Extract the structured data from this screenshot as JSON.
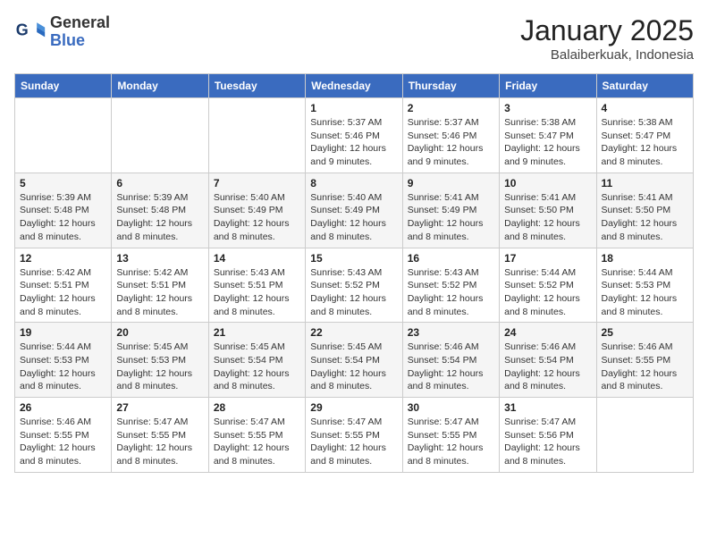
{
  "logo": {
    "line1": "General",
    "line2": "Blue"
  },
  "title": "January 2025",
  "subtitle": "Balaiberkuak, Indonesia",
  "headers": [
    "Sunday",
    "Monday",
    "Tuesday",
    "Wednesday",
    "Thursday",
    "Friday",
    "Saturday"
  ],
  "weeks": [
    [
      {
        "day": "",
        "info": ""
      },
      {
        "day": "",
        "info": ""
      },
      {
        "day": "",
        "info": ""
      },
      {
        "day": "1",
        "info": "Sunrise: 5:37 AM\nSunset: 5:46 PM\nDaylight: 12 hours and 9 minutes."
      },
      {
        "day": "2",
        "info": "Sunrise: 5:37 AM\nSunset: 5:46 PM\nDaylight: 12 hours and 9 minutes."
      },
      {
        "day": "3",
        "info": "Sunrise: 5:38 AM\nSunset: 5:47 PM\nDaylight: 12 hours and 9 minutes."
      },
      {
        "day": "4",
        "info": "Sunrise: 5:38 AM\nSunset: 5:47 PM\nDaylight: 12 hours and 8 minutes."
      }
    ],
    [
      {
        "day": "5",
        "info": "Sunrise: 5:39 AM\nSunset: 5:48 PM\nDaylight: 12 hours and 8 minutes."
      },
      {
        "day": "6",
        "info": "Sunrise: 5:39 AM\nSunset: 5:48 PM\nDaylight: 12 hours and 8 minutes."
      },
      {
        "day": "7",
        "info": "Sunrise: 5:40 AM\nSunset: 5:49 PM\nDaylight: 12 hours and 8 minutes."
      },
      {
        "day": "8",
        "info": "Sunrise: 5:40 AM\nSunset: 5:49 PM\nDaylight: 12 hours and 8 minutes."
      },
      {
        "day": "9",
        "info": "Sunrise: 5:41 AM\nSunset: 5:49 PM\nDaylight: 12 hours and 8 minutes."
      },
      {
        "day": "10",
        "info": "Sunrise: 5:41 AM\nSunset: 5:50 PM\nDaylight: 12 hours and 8 minutes."
      },
      {
        "day": "11",
        "info": "Sunrise: 5:41 AM\nSunset: 5:50 PM\nDaylight: 12 hours and 8 minutes."
      }
    ],
    [
      {
        "day": "12",
        "info": "Sunrise: 5:42 AM\nSunset: 5:51 PM\nDaylight: 12 hours and 8 minutes."
      },
      {
        "day": "13",
        "info": "Sunrise: 5:42 AM\nSunset: 5:51 PM\nDaylight: 12 hours and 8 minutes."
      },
      {
        "day": "14",
        "info": "Sunrise: 5:43 AM\nSunset: 5:51 PM\nDaylight: 12 hours and 8 minutes."
      },
      {
        "day": "15",
        "info": "Sunrise: 5:43 AM\nSunset: 5:52 PM\nDaylight: 12 hours and 8 minutes."
      },
      {
        "day": "16",
        "info": "Sunrise: 5:43 AM\nSunset: 5:52 PM\nDaylight: 12 hours and 8 minutes."
      },
      {
        "day": "17",
        "info": "Sunrise: 5:44 AM\nSunset: 5:52 PM\nDaylight: 12 hours and 8 minutes."
      },
      {
        "day": "18",
        "info": "Sunrise: 5:44 AM\nSunset: 5:53 PM\nDaylight: 12 hours and 8 minutes."
      }
    ],
    [
      {
        "day": "19",
        "info": "Sunrise: 5:44 AM\nSunset: 5:53 PM\nDaylight: 12 hours and 8 minutes."
      },
      {
        "day": "20",
        "info": "Sunrise: 5:45 AM\nSunset: 5:53 PM\nDaylight: 12 hours and 8 minutes."
      },
      {
        "day": "21",
        "info": "Sunrise: 5:45 AM\nSunset: 5:54 PM\nDaylight: 12 hours and 8 minutes."
      },
      {
        "day": "22",
        "info": "Sunrise: 5:45 AM\nSunset: 5:54 PM\nDaylight: 12 hours and 8 minutes."
      },
      {
        "day": "23",
        "info": "Sunrise: 5:46 AM\nSunset: 5:54 PM\nDaylight: 12 hours and 8 minutes."
      },
      {
        "day": "24",
        "info": "Sunrise: 5:46 AM\nSunset: 5:54 PM\nDaylight: 12 hours and 8 minutes."
      },
      {
        "day": "25",
        "info": "Sunrise: 5:46 AM\nSunset: 5:55 PM\nDaylight: 12 hours and 8 minutes."
      }
    ],
    [
      {
        "day": "26",
        "info": "Sunrise: 5:46 AM\nSunset: 5:55 PM\nDaylight: 12 hours and 8 minutes."
      },
      {
        "day": "27",
        "info": "Sunrise: 5:47 AM\nSunset: 5:55 PM\nDaylight: 12 hours and 8 minutes."
      },
      {
        "day": "28",
        "info": "Sunrise: 5:47 AM\nSunset: 5:55 PM\nDaylight: 12 hours and 8 minutes."
      },
      {
        "day": "29",
        "info": "Sunrise: 5:47 AM\nSunset: 5:55 PM\nDaylight: 12 hours and 8 minutes."
      },
      {
        "day": "30",
        "info": "Sunrise: 5:47 AM\nSunset: 5:55 PM\nDaylight: 12 hours and 8 minutes."
      },
      {
        "day": "31",
        "info": "Sunrise: 5:47 AM\nSunset: 5:56 PM\nDaylight: 12 hours and 8 minutes."
      },
      {
        "day": "",
        "info": ""
      }
    ]
  ]
}
